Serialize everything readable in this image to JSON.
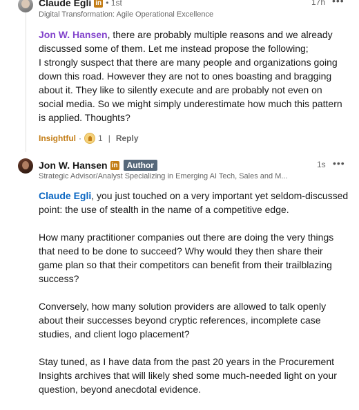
{
  "comments": [
    {
      "name": "Claude Egli",
      "linkedin_badge": "in",
      "degree": "• 1st",
      "headline": "Digital Transformation: Agile Operational Excellence",
      "time": "17h",
      "more": "•••",
      "mention": "Jon W. Hansen",
      "text_line1": ", there are probably multiple reasons and we already discussed some of them. Let me instead propose the following;",
      "text_rest": "I strongly suspect that there are many people and organizations going down this road. However they are not to ones boasting and bragging about it. They like to silently execute and are probably not even on social media. So we might simply underestimate how much this pattern is applied. Thoughts?",
      "reaction_label": "Insightful",
      "reaction_sep": "·",
      "reaction_count": "1",
      "action_sep": "|",
      "reply_label": "Reply"
    },
    {
      "name": "Jon W. Hansen",
      "linkedin_badge": "in",
      "author_badge": "Author",
      "headline": "Strategic Advisor/Analyst Specializing in Emerging AI Tech, Sales and M...",
      "time": "1s",
      "more": "•••",
      "mention": "Claude Egli",
      "para1": ", you just touched on a very important yet seldom-discussed point: the use of stealth in the name of a competitive edge.",
      "para2": "How many practitioner companies out there are doing the very things that need to be done to succeed? Why would they then share their game plan so that their competitors can benefit from their trailblazing success?",
      "para3": "Conversely, how many solution providers are allowed to talk openly about their successes beyond cryptic references, incomplete case studies, and client logo placement?",
      "para4": "Stay tuned, as I have data from the past 20 years in the Procurement Insights archives that will likely shed some much-needed light on your question, beyond anecdotal evidence."
    }
  ]
}
